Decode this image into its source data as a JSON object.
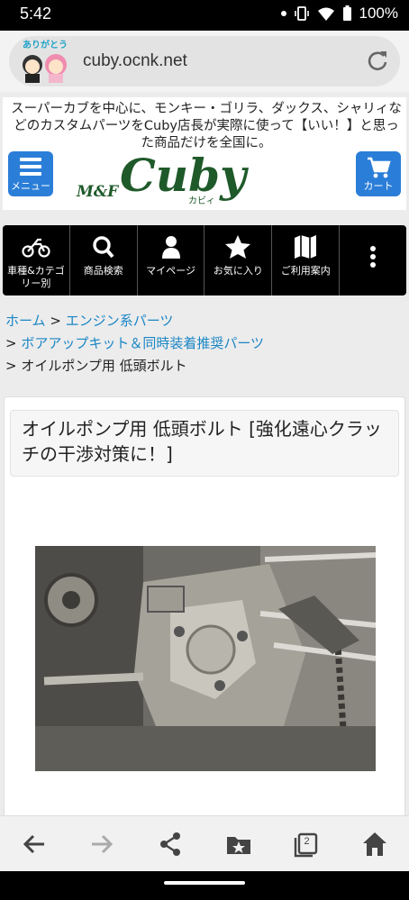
{
  "status_bar": {
    "time": "5:42",
    "battery": "100%"
  },
  "browser": {
    "url": "cuby.ocnk.net",
    "mascot_text": "ありがとう"
  },
  "header": {
    "tagline": "スーパーカブを中心に、モンキー・ゴリラ、ダックス、シャリィなどのカスタムパーツをCuby店長が実際に使って【いい！】と思った商品だけを全国に。",
    "menu_label": "メニュー",
    "cart_label": "カート",
    "logo_prefix": "M&F",
    "logo_main": "Cuby",
    "logo_kana": "カビィ"
  },
  "nav": {
    "items": [
      {
        "label": "車種&カテゴリー別",
        "icon": "motorcycle-icon"
      },
      {
        "label": "商品検索",
        "icon": "search-icon"
      },
      {
        "label": "マイページ",
        "icon": "user-icon"
      },
      {
        "label": "お気に入り",
        "icon": "star-icon"
      },
      {
        "label": "ご利用案内",
        "icon": "map-icon"
      },
      {
        "label": "",
        "icon": "more-vertical-icon"
      }
    ]
  },
  "breadcrumb": {
    "home": "ホーム",
    "cat1": "エンジン系パーツ",
    "cat2": "ボアアップキット＆同時装着推奨パーツ",
    "current": "オイルポンプ用 低頭ボルト",
    "sep": ">"
  },
  "product": {
    "title": "オイルポンプ用 低頭ボルト [強化遠心クラッチの干渉対策に！]"
  },
  "bottom_nav": {
    "tab_count": "2",
    "icons": [
      "back-arrow-icon",
      "forward-arrow-icon",
      "share-icon",
      "bookmarks-icon",
      "tabs-icon",
      "home-icon"
    ]
  },
  "colors": {
    "accent_blue": "#2b7ed8",
    "link_blue": "#1a86c6",
    "logo_green": "#1f5a2a"
  }
}
